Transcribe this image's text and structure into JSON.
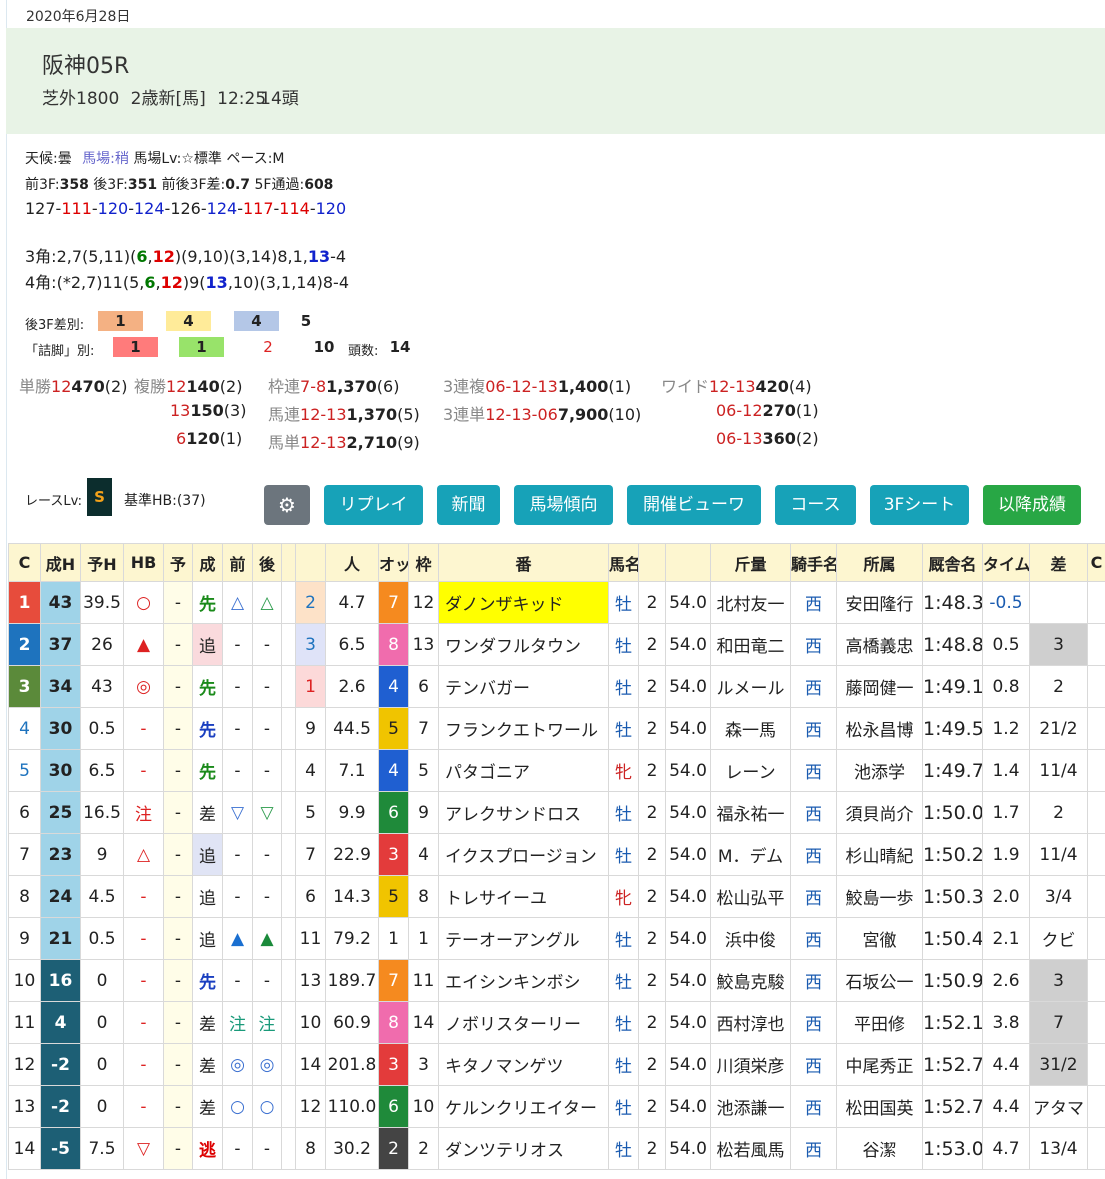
{
  "date": "2020年6月28日",
  "race": {
    "name": "阪神05R",
    "course": "芝外1800",
    "class": "2歳新[馬]",
    "time": "12:25",
    "heads": "14頭"
  },
  "cond": {
    "weather_label": "天候:",
    "weather": "曇",
    "baba_label": "馬場:",
    "baba": "稍",
    "lv_label": "馬場Lv:☆標準",
    "pace_label": "ペース:",
    "pace": "M"
  },
  "stats": {
    "f3_label": "前3F:",
    "f3": "358",
    "l3_label": "後3F:",
    "l3": "351",
    "diff_label": "前後3F差:",
    "diff": "0.7",
    "f5_label": "5F通過:",
    "f5": "608"
  },
  "laps": [
    {
      "v": "127",
      "c": "#222"
    },
    {
      "v": "111",
      "c": "#d00"
    },
    {
      "v": "120",
      "c": "#12c"
    },
    {
      "v": "124",
      "c": "#12c"
    },
    {
      "v": "126",
      "c": "#222"
    },
    {
      "v": "124",
      "c": "#12c"
    },
    {
      "v": "117",
      "c": "#d00"
    },
    {
      "v": "114",
      "c": "#d00"
    },
    {
      "v": "120",
      "c": "#12c"
    }
  ],
  "corners": {
    "c3": [
      {
        "t": "3角:2,7(5,11)(",
        "c": ""
      },
      {
        "t": "6",
        "c": "green"
      },
      {
        "t": ",",
        "c": ""
      },
      {
        "t": "12",
        "c": "red"
      },
      {
        "t": ")(9,10)(3,14)8,1,",
        "c": ""
      },
      {
        "t": "13",
        "c": "blue"
      },
      {
        "t": "-4",
        "c": ""
      }
    ],
    "c4": [
      {
        "t": "4角:(*2,7)11(5,",
        "c": ""
      },
      {
        "t": "6",
        "c": "green"
      },
      {
        "t": ",",
        "c": ""
      },
      {
        "t": "12",
        "c": "red"
      },
      {
        "t": ")9(",
        "c": ""
      },
      {
        "t": "13",
        "c": "blue"
      },
      {
        "t": ",10)(3,1,14)8-4",
        "c": ""
      }
    ]
  },
  "diff3f": {
    "label": "後3F差別:",
    "vals": [
      "1",
      "4",
      "4",
      "5"
    ]
  },
  "tsume": {
    "label": "「詰脚」別:",
    "vals": [
      "1",
      "1",
      "2",
      "10"
    ],
    "heads_label": "頭数:",
    "heads": "14"
  },
  "payouts": [
    {
      "k": "単勝",
      "n": "12",
      "v": "470",
      "p": "(2)"
    },
    {
      "k": "複勝",
      "n": "12",
      "v": "140",
      "p": "(2)"
    },
    {
      "k": "",
      "n": "13",
      "v": "150",
      "p": "(3)"
    },
    {
      "k": "",
      "n": "6",
      "v": "120",
      "p": "(1)"
    },
    {
      "k": "枠連",
      "n": "7-8",
      "v": "1,370",
      "p": "(6)"
    },
    {
      "k": "馬連",
      "n": "12-13",
      "v": "1,370",
      "p": "(5)"
    },
    {
      "k": "馬単",
      "n": "12-13",
      "v": "2,710",
      "p": "(9)"
    },
    {
      "k": "3連複",
      "n": "06-12-13",
      "v": "1,400",
      "p": "(1)"
    },
    {
      "k": "3連単",
      "n": "12-13-06",
      "v": "7,900",
      "p": "(10)"
    },
    {
      "k": "ワイド",
      "n": "12-13",
      "v": "420",
      "p": "(4)"
    },
    {
      "k": "",
      "n": "06-12",
      "v": "270",
      "p": "(1)"
    },
    {
      "k": "",
      "n": "06-13",
      "v": "360",
      "p": "(2)"
    }
  ],
  "race_lv": {
    "label": "レースLv:",
    "badge": "S",
    "kijun": "基準HB:(37)"
  },
  "buttons": {
    "gear": "⚙",
    "replay": "リプレイ",
    "news": "新聞",
    "baba": "馬場傾向",
    "viewer": "開催ビューワ",
    "course": "コース",
    "sheet": "3Fシート",
    "later": "以降成績"
  },
  "headers": [
    "C",
    "成H",
    "予H",
    "HB",
    "予",
    "成",
    "前",
    "後",
    "",
    "人",
    "オッ",
    "枠",
    "番",
    "馬名",
    "",
    "",
    "斤量",
    "騎手名",
    "所属",
    "厩舎名",
    "タイム",
    "差",
    "C"
  ],
  "rows": [
    [
      "1",
      "43",
      "39.5",
      "○",
      "-",
      "先",
      "△",
      "△",
      "2",
      "4.7",
      "7",
      "12",
      "ダノンザキッド",
      "牡",
      "2",
      "54.0",
      "北村友一",
      "西",
      "安田隆行",
      "1:48.3",
      "-0.5",
      ""
    ],
    [
      "2",
      "37",
      "26",
      "▲",
      "-",
      "追",
      "-",
      "-",
      "3",
      "6.5",
      "8",
      "13",
      "ワンダフルタウン",
      "牡",
      "2",
      "54.0",
      "和田竜二",
      "西",
      "高橋義忠",
      "1:48.8",
      "0.5",
      "3"
    ],
    [
      "3",
      "34",
      "43",
      "◎",
      "-",
      "先",
      "-",
      "-",
      "1",
      "2.6",
      "4",
      "6",
      "テンバガー",
      "牡",
      "2",
      "54.0",
      "ルメール",
      "西",
      "藤岡健一",
      "1:49.1",
      "0.8",
      "2"
    ],
    [
      "4",
      "30",
      "0.5",
      "-",
      "-",
      "先",
      "-",
      "-",
      "9",
      "44.5",
      "5",
      "7",
      "フランクエトワール",
      "牡",
      "2",
      "54.0",
      "森一馬",
      "西",
      "松永昌博",
      "1:49.5",
      "1.2",
      "21/2"
    ],
    [
      "5",
      "30",
      "6.5",
      "-",
      "-",
      "先",
      "-",
      "-",
      "4",
      "7.1",
      "4",
      "5",
      "パタゴニア",
      "牝",
      "2",
      "54.0",
      "レーン",
      "西",
      "池添学",
      "1:49.7",
      "1.4",
      "11/4"
    ],
    [
      "6",
      "25",
      "16.5",
      "注",
      "-",
      "差",
      "▽",
      "▽",
      "5",
      "9.9",
      "6",
      "9",
      "アレクサンドロス",
      "牡",
      "2",
      "54.0",
      "福永祐一",
      "西",
      "須貝尚介",
      "1:50.0",
      "1.7",
      "2"
    ],
    [
      "7",
      "23",
      "9",
      "△",
      "-",
      "追",
      "-",
      "-",
      "7",
      "22.9",
      "3",
      "4",
      "イクスプロージョン",
      "牡",
      "2",
      "54.0",
      "M．デム",
      "西",
      "杉山晴紀",
      "1:50.2",
      "1.9",
      "11/4"
    ],
    [
      "8",
      "24",
      "4.5",
      "-",
      "-",
      "追",
      "-",
      "-",
      "6",
      "14.3",
      "5",
      "8",
      "トレサイーユ",
      "牝",
      "2",
      "54.0",
      "松山弘平",
      "西",
      "鮫島一歩",
      "1:50.3",
      "2.0",
      "3/4"
    ],
    [
      "9",
      "21",
      "0.5",
      "-",
      "-",
      "追",
      "▲",
      "▲",
      "11",
      "79.2",
      "1",
      "1",
      "テーオーアングル",
      "牡",
      "2",
      "54.0",
      "浜中俊",
      "西",
      "宮徹",
      "1:50.4",
      "2.1",
      "クビ"
    ],
    [
      "10",
      "16",
      "0",
      "-",
      "-",
      "先",
      "-",
      "-",
      "13",
      "189.7",
      "7",
      "11",
      "エイシンキンボシ",
      "牡",
      "2",
      "54.0",
      "鮫島克駿",
      "西",
      "石坂公一",
      "1:50.9",
      "2.6",
      "3"
    ],
    [
      "11",
      "4",
      "0",
      "-",
      "-",
      "差",
      "注",
      "注",
      "10",
      "60.9",
      "8",
      "14",
      "ノボリスターリー",
      "牡",
      "2",
      "54.0",
      "西村淳也",
      "西",
      "平田修",
      "1:52.1",
      "3.8",
      "7"
    ],
    [
      "12",
      "-2",
      "0",
      "-",
      "-",
      "差",
      "◎",
      "◎",
      "14",
      "201.8",
      "3",
      "3",
      "キタノマンゲツ",
      "牡",
      "2",
      "54.0",
      "川須栄彦",
      "西",
      "中尾秀正",
      "1:52.7",
      "4.4",
      "31/2"
    ],
    [
      "13",
      "-2",
      "0",
      "-",
      "-",
      "差",
      "○",
      "○",
      "12",
      "110.0",
      "6",
      "10",
      "ケルンクリエイター",
      "牡",
      "2",
      "54.0",
      "池添謙一",
      "西",
      "松田国英",
      "1:52.7",
      "4.4",
      "アタマ"
    ],
    [
      "14",
      "-5",
      "7.5",
      "▽",
      "-",
      "逃",
      "-",
      "-",
      "8",
      "30.2",
      "2",
      "2",
      "ダンツテリオス",
      "牡",
      "2",
      "54.0",
      "松若風馬",
      "西",
      "谷潔",
      "1:53.0",
      "4.7",
      "13/4"
    ]
  ]
}
